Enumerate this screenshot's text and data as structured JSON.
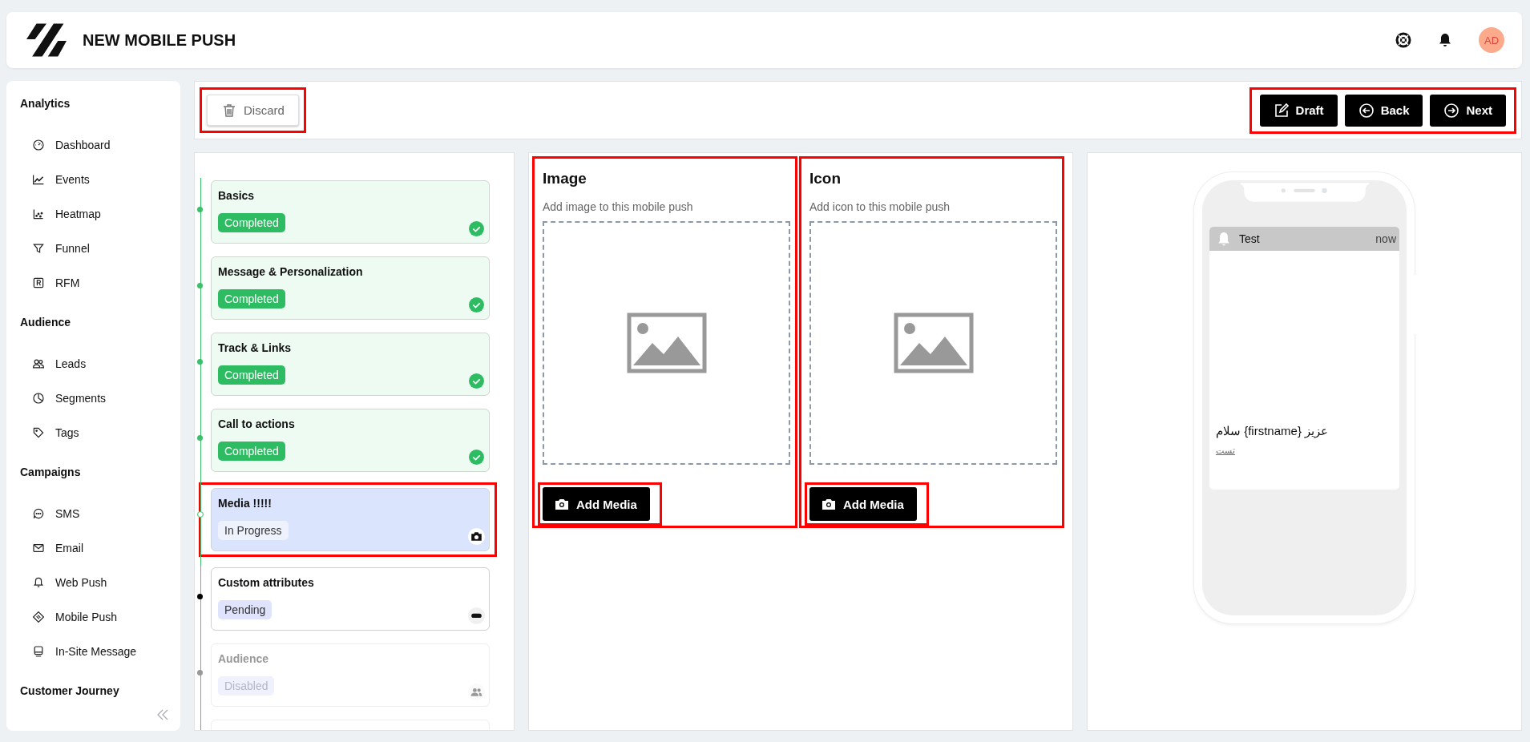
{
  "header": {
    "title": "NEW MOBILE PUSH",
    "avatar": "AD"
  },
  "sidebar": {
    "sections": [
      {
        "title": "Analytics",
        "items": [
          {
            "label": "Dashboard"
          },
          {
            "label": "Events"
          },
          {
            "label": "Heatmap"
          },
          {
            "label": "Funnel"
          },
          {
            "label": "RFM"
          }
        ]
      },
      {
        "title": "Audience",
        "items": [
          {
            "label": "Leads"
          },
          {
            "label": "Segments"
          },
          {
            "label": "Tags"
          }
        ]
      },
      {
        "title": "Campaigns",
        "items": [
          {
            "label": "SMS"
          },
          {
            "label": "Email"
          },
          {
            "label": "Web Push"
          },
          {
            "label": "Mobile Push"
          },
          {
            "label": "In-Site Message"
          }
        ]
      },
      {
        "title": "Customer Journey"
      }
    ]
  },
  "toolbar": {
    "discard": {
      "label": "Discard",
      "highlighted": true
    },
    "actions_highlighted": true,
    "actions": [
      {
        "label": "Draft",
        "kind": "edit"
      },
      {
        "label": "Back",
        "kind": "back"
      },
      {
        "label": "Next",
        "kind": "next"
      }
    ]
  },
  "steps": [
    {
      "title": "Basics",
      "status": "Completed",
      "kind": "completed",
      "highlighted": false
    },
    {
      "title": "Message & Personalization",
      "status": "Completed",
      "kind": "completed",
      "highlighted": false
    },
    {
      "title": "Track & Links",
      "status": "Completed",
      "kind": "completed",
      "highlighted": false
    },
    {
      "title": "Call to actions",
      "status": "Completed",
      "kind": "completed",
      "highlighted": false
    },
    {
      "title": "Media !!!!!",
      "status": "In Progress",
      "kind": "in_progress",
      "highlighted": true
    },
    {
      "title": "Custom attributes",
      "status": "Pending",
      "kind": "pending",
      "highlighted": false
    },
    {
      "title": "Audience",
      "status": "Disabled",
      "kind": "disabled",
      "highlighted": false
    },
    {
      "kind": "disabled",
      "highlighted": false
    }
  ],
  "media": [
    {
      "title": "Image",
      "hint": "Add image to this mobile push",
      "button": "Add Media",
      "highlighted": true,
      "button_highlighted": true
    },
    {
      "title": "Icon",
      "hint": "Add icon to this mobile push",
      "button": "Add Media",
      "highlighted": true,
      "button_highlighted": true
    }
  ],
  "preview": {
    "app": "Test",
    "time": "now",
    "title": "عزیز {firstname} سلام",
    "body": "تست"
  }
}
